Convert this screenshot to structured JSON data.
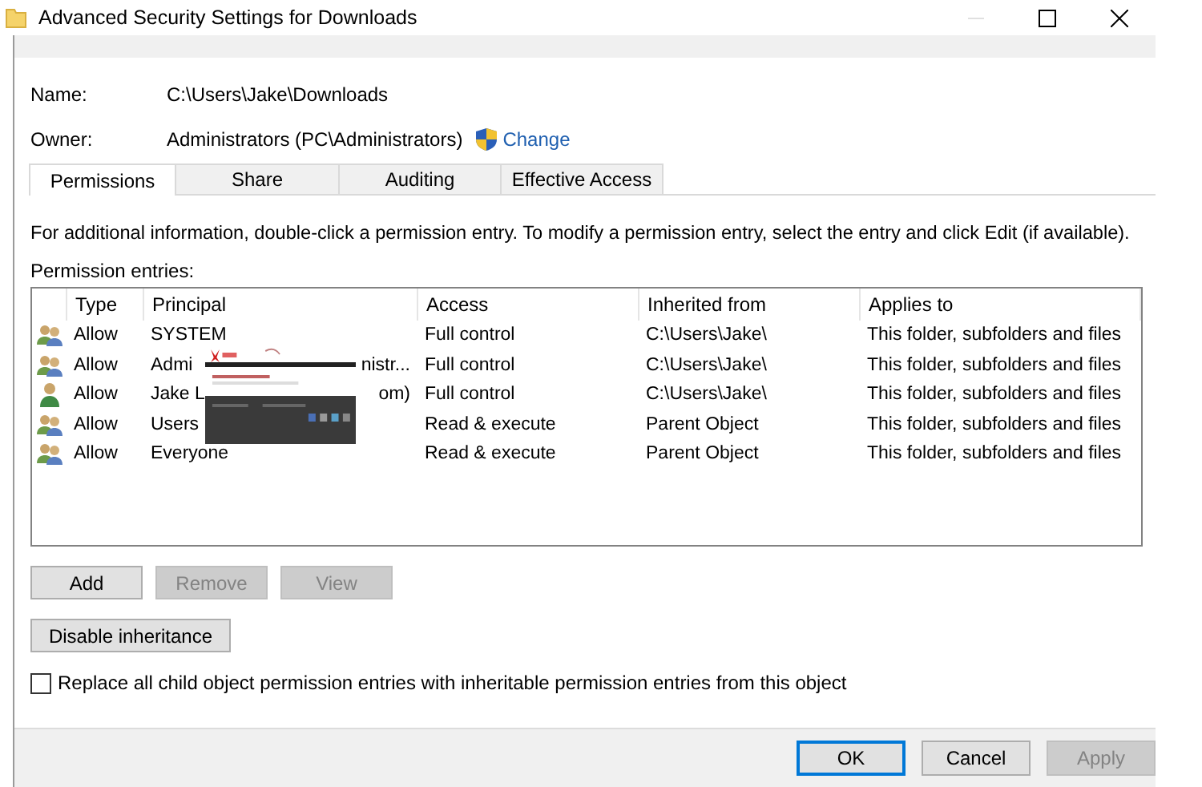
{
  "window": {
    "title": "Advanced Security Settings for Downloads"
  },
  "name": {
    "label": "Name:",
    "value": "C:\\Users\\Jake\\Downloads"
  },
  "owner": {
    "label": "Owner:",
    "value": "Administrators (PC\\Administrators)",
    "link": "Change"
  },
  "tabs": [
    {
      "label": "Permissions",
      "selected": true
    },
    {
      "label": "Share",
      "selected": false
    },
    {
      "label": "Auditing",
      "selected": false
    },
    {
      "label": "Effective Access",
      "selected": false
    }
  ],
  "description": "For additional information, double-click a permission entry. To modify a permission entry, select the entry and click Edit (if available).",
  "entries_label": "Permission entries:",
  "table": {
    "columns": [
      "Type",
      "Principal",
      "Access",
      "Inherited from",
      "Applies to"
    ],
    "rows": [
      {
        "kind": "group",
        "type": "Allow",
        "principal": "SYSTEM",
        "access": "Full control",
        "inherited": "C:\\Users\\Jake\\",
        "applies": "This folder, subfolders and files"
      },
      {
        "kind": "group",
        "type": "Allow",
        "principal": "Admi",
        "principal_tail": "nistr...",
        "access": "Full control",
        "inherited": "C:\\Users\\Jake\\",
        "applies": "This folder, subfolders and files"
      },
      {
        "kind": "user",
        "type": "Allow",
        "principal": "Jake L",
        "principal_tail": "om)",
        "access": "Full control",
        "inherited": "C:\\Users\\Jake\\",
        "applies": "This folder, subfolders and files"
      },
      {
        "kind": "group",
        "type": "Allow",
        "principal": "Users",
        "access": "Read & execute",
        "inherited": "Parent Object",
        "applies": "This folder, subfolders and files"
      },
      {
        "kind": "group",
        "type": "Allow",
        "principal": "Everyone",
        "access": "Read & execute",
        "inherited": "Parent Object",
        "applies": "This folder, subfolders and files"
      }
    ]
  },
  "entry_buttons": [
    {
      "label": "Add",
      "disabled": false
    },
    {
      "label": "Remove",
      "disabled": true
    },
    {
      "label": "View",
      "disabled": true
    }
  ],
  "inheritance_button": {
    "label": "Disable inheritance",
    "disabled": false
  },
  "replace_checkbox": {
    "label": "Replace all child object permission entries with inheritable permission entries from this object",
    "checked": false
  },
  "footer_buttons": [
    {
      "label": "OK",
      "disabled": false,
      "default": true
    },
    {
      "label": "Cancel",
      "disabled": false,
      "default": false
    },
    {
      "label": "Apply",
      "disabled": true,
      "default": false
    }
  ]
}
